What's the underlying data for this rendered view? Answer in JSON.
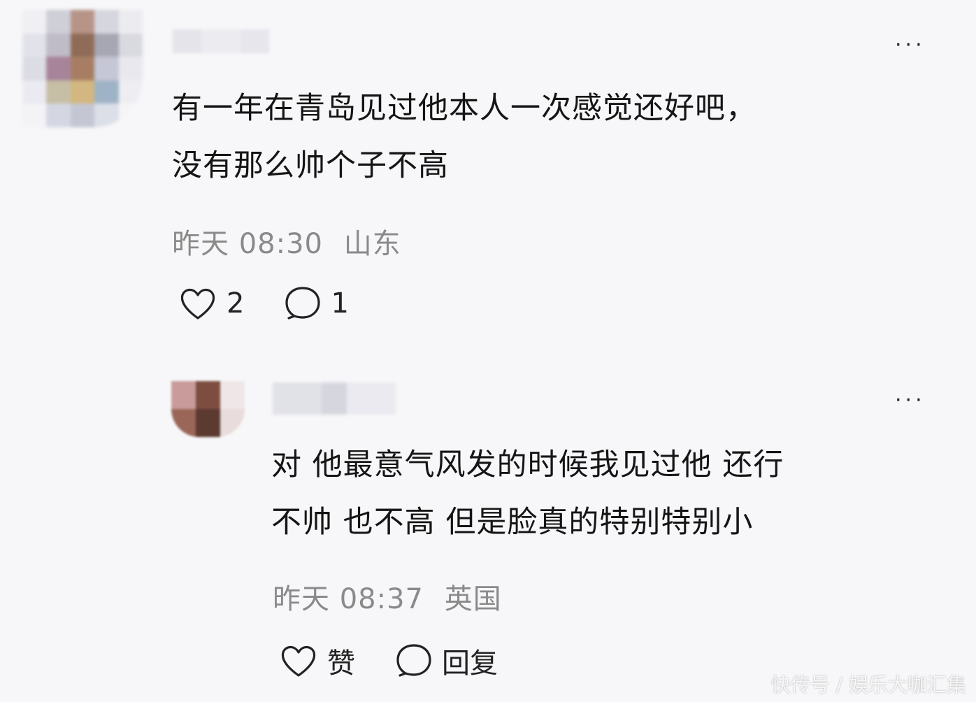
{
  "comments": [
    {
      "text_lines": [
        "有一年在青岛见过他本人一次感觉还好吧，",
        "没有那么帅个子不高"
      ],
      "time": "昨天 08:30",
      "location": "山东",
      "like_label": "2",
      "reply_label": "1",
      "icons": {
        "like": "heart-icon",
        "reply": "comment-bubble-icon",
        "more": "more-dots-icon"
      },
      "more_label": "···"
    },
    {
      "text_lines": [
        "对 他最意气风发的时候我见过他 还行",
        "不帅 也不高 但是脸真的特别特别小"
      ],
      "time": "昨天 08:37",
      "location": "英国",
      "like_label": "赞",
      "reply_label": "回复",
      "icons": {
        "like": "heart-icon",
        "reply": "comment-bubble-icon",
        "more": "more-dots-icon"
      },
      "more_label": "···"
    }
  ],
  "watermark": "快传号 / 娱乐大咖汇集",
  "colors": {
    "background": "#f7f7f9",
    "text": "#151515",
    "meta": "#8a8a8a"
  }
}
